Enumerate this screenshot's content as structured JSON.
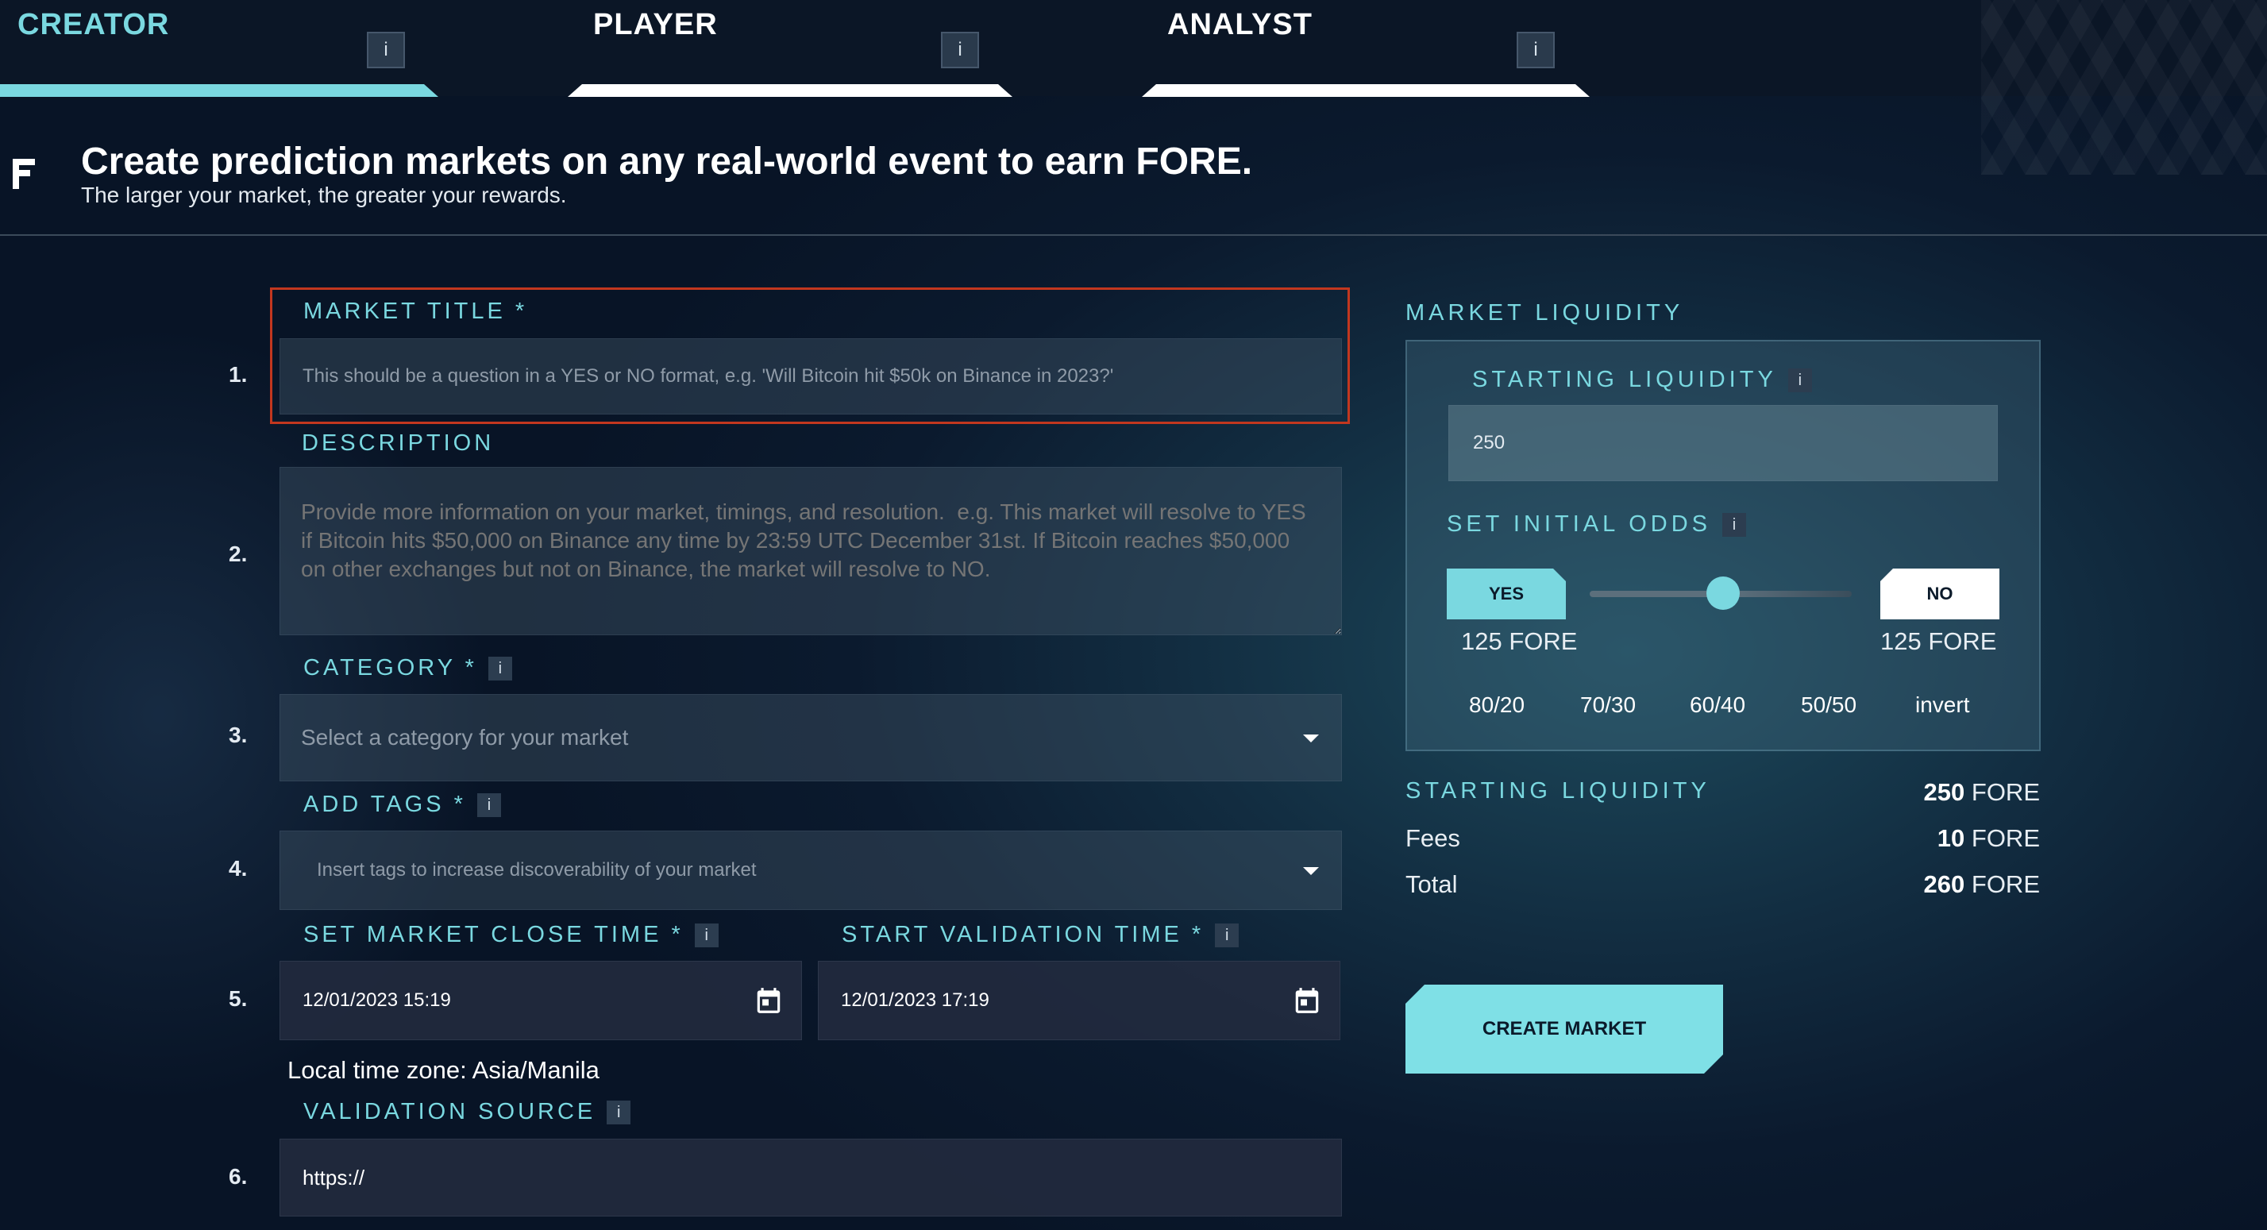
{
  "tabs": [
    {
      "label": "CREATOR",
      "info": "i"
    },
    {
      "label": "PLAYER",
      "info": "i"
    },
    {
      "label": "ANALYST",
      "info": "i"
    }
  ],
  "header": {
    "title": "Create prediction markets on any real-world event to earn FORE.",
    "subtitle": "The larger your market, the greater your rewards."
  },
  "form": {
    "market_title": {
      "number": "1.",
      "label": "MARKET TITLE *",
      "placeholder": "This should be a question in a YES or NO format,  e.g. 'Will Bitcoin hit $50k on Binance in 2023?'"
    },
    "description": {
      "number": "2.",
      "label": "DESCRIPTION",
      "placeholder": "Provide more information on your market, timings, and resolution.  e.g. This market will resolve to YES if Bitcoin hits $50,000 on Binance any time by 23:59 UTC December 31st. If Bitcoin reaches $50,000 on other exchanges but not on Binance, the market will resolve to NO."
    },
    "category": {
      "number": "3.",
      "label": "CATEGORY *",
      "info": "i",
      "placeholder": "Select a category for your market"
    },
    "tags": {
      "number": "4.",
      "label": "ADD TAGS *",
      "info": "i",
      "placeholder": "Insert tags to increase discoverability of your market"
    },
    "close_time": {
      "number": "5.",
      "label": "SET MARKET CLOSE TIME *",
      "info": "i",
      "value": "12/01/2023 15:19"
    },
    "validation_time": {
      "label": "START VALIDATION TIME *",
      "info": "i",
      "value": "12/01/2023 17:19"
    },
    "timezone": "Local time zone: Asia/Manila",
    "validation_source": {
      "number": "6.",
      "label": "VALIDATION SOURCE",
      "info": "i",
      "value": "https://"
    }
  },
  "liquidity": {
    "section_label": "MARKET LIQUIDITY",
    "starting_label": "STARTING LIQUIDITY",
    "starting_info": "i",
    "starting_value": "250",
    "odds_label": "SET INITIAL ODDS",
    "odds_info": "i",
    "yes_label": "YES",
    "no_label": "NO",
    "yes_amount": "125 FORE",
    "no_amount": "125 FORE",
    "slider_value": 0.5,
    "presets": [
      "80/20",
      "70/30",
      "60/40",
      "50/50",
      "invert"
    ]
  },
  "summary": {
    "starting_label": "STARTING LIQUIDITY",
    "starting_amount": "250",
    "starting_unit": " FORE",
    "fees_label": "Fees",
    "fees_amount": "10",
    "fees_unit": " FORE",
    "total_label": "Total",
    "total_amount": "260",
    "total_unit": " FORE"
  },
  "create_button": "CREATE MARKET",
  "colors": {
    "accent": "#7ad8e0",
    "highlight": "#c2371f",
    "background": "#0b1a2e"
  }
}
